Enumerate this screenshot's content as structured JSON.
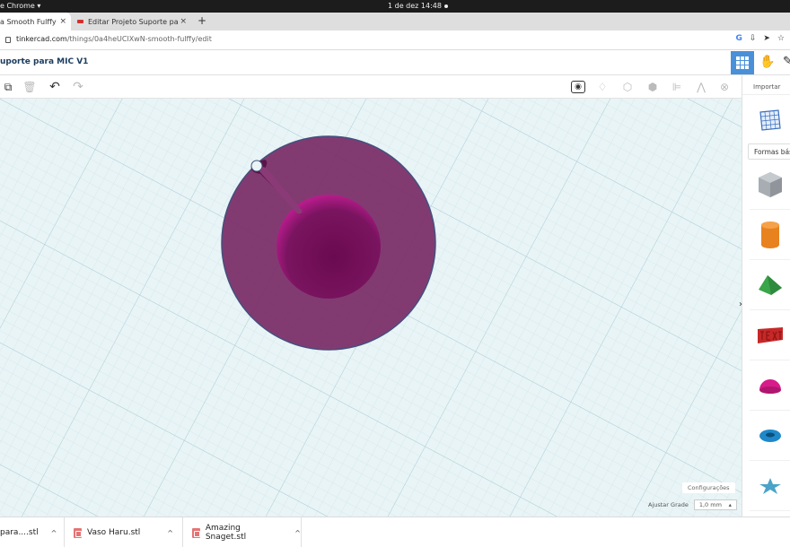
{
  "os": {
    "app_menu": "e Chrome ▾",
    "clock": "1 de dez  14:48"
  },
  "browser": {
    "tabs": [
      {
        "title": "a Smooth Fulffy",
        "close": "×"
      },
      {
        "title": "Editar Projeto Suporte pa",
        "close": "×"
      }
    ],
    "new_tab": "+",
    "url_host": "tinkercad.com",
    "url_path": "/things/0a4heUClXwN-smooth-fulffy/edit",
    "address_icons": [
      "G",
      "⇩",
      "➤",
      "☆"
    ]
  },
  "app": {
    "project_title": "uporte para MIC V1",
    "import_label": "Importar",
    "shapes_dropdown_label": "Formas básicas",
    "panel_chevron": "›",
    "settings_label": "Configurações",
    "snap_grid_label": "Ajustar Grade",
    "snap_grid_value": "1,0 mm",
    "snap_grid_arrow": "▴"
  },
  "toolbar": {
    "left": [
      {
        "name": "copy-icon",
        "glyph": "⧉"
      },
      {
        "name": "trash-icon",
        "glyph": "🗑"
      },
      {
        "name": "undo-icon",
        "glyph": "↶"
      },
      {
        "name": "redo-icon",
        "glyph": "↷"
      }
    ],
    "right": [
      {
        "name": "view-icon",
        "glyph": "◉"
      },
      {
        "name": "light-bulb-icon",
        "glyph": "♢"
      },
      {
        "name": "group-icon",
        "glyph": "⬡"
      },
      {
        "name": "ungroup-icon",
        "glyph": "⬢"
      },
      {
        "name": "align-icon",
        "glyph": "⊫"
      },
      {
        "name": "mirror-icon",
        "glyph": "⋀"
      },
      {
        "name": "magnet-icon",
        "glyph": "⊗"
      }
    ]
  },
  "shapes": [
    {
      "name": "workplane-shape",
      "color": "#3c6fbf"
    },
    {
      "name": "box-hole-shape",
      "color": "#9aa1a8"
    },
    {
      "name": "cylinder-shape",
      "color": "#e8821e"
    },
    {
      "name": "roof-shape",
      "color": "#3aa54a"
    },
    {
      "name": "text-shape",
      "color": "#c62828"
    },
    {
      "name": "half-sphere-shape",
      "color": "#d81b8a"
    },
    {
      "name": "torus-shape",
      "color": "#1e88c9"
    },
    {
      "name": "star-shape",
      "color": "#4aa3c8"
    }
  ],
  "downloads": [
    {
      "name": "para....stl",
      "caret": "^"
    },
    {
      "name": "Vaso Haru.stl",
      "caret": "^"
    },
    {
      "name": "Amazing Snaget.stl",
      "caret": "^"
    }
  ],
  "colors": {
    "model_outer": "#7a2c66",
    "model_inner": "#6e0f55",
    "workplane_bg": "#e9f4f6",
    "accent": "#4a90d9"
  }
}
